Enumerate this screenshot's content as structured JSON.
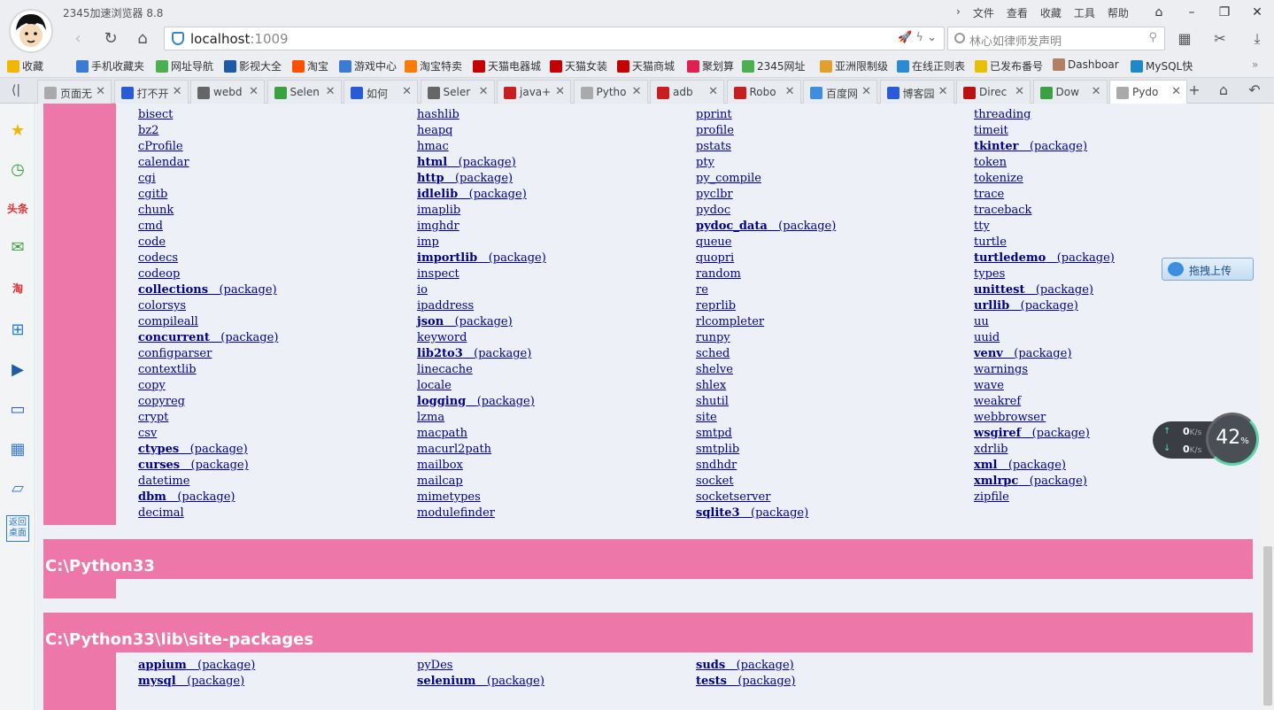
{
  "browser": {
    "title": "2345加速浏览器 8.8",
    "menu": [
      "文件",
      "查看",
      "收藏",
      "工具",
      "帮助"
    ],
    "address": "localhost",
    "port": ":1009",
    "search_placeholder": "林心如律师发声明"
  },
  "bookmarks": [
    {
      "label": "收藏",
      "icon": "star-icon"
    },
    {
      "label": "手机收藏夹",
      "icon": "phone-icon"
    },
    {
      "label": "网址导航",
      "icon": "nav-icon"
    },
    {
      "label": "影视大全",
      "icon": "film-icon"
    },
    {
      "label": "淘宝",
      "icon": "taobao-icon"
    },
    {
      "label": "游戏中心",
      "icon": "game-icon"
    },
    {
      "label": "淘宝特卖",
      "icon": "sale-icon"
    },
    {
      "label": "天猫电器城",
      "icon": "tmall-icon"
    },
    {
      "label": "天猫女装",
      "icon": "tmall-icon"
    },
    {
      "label": "天猫商城",
      "icon": "tmall-icon"
    },
    {
      "label": "聚划算",
      "icon": "juhuasuan-icon"
    },
    {
      "label": "2345网址",
      "icon": "nav-icon"
    },
    {
      "label": "亚洲限制级",
      "icon": "folder-icon"
    },
    {
      "label": "在线正则表",
      "icon": "regex-icon"
    },
    {
      "label": "已发布番号",
      "icon": "radiation-icon"
    },
    {
      "label": "Dashboar",
      "icon": "user-icon"
    },
    {
      "label": "MySQL快",
      "icon": "mysql-icon"
    }
  ],
  "tabs": [
    {
      "label": "页面无",
      "icon": "page-icon"
    },
    {
      "label": "打不开",
      "icon": "paw-icon"
    },
    {
      "label": "webd",
      "icon": "w-icon"
    },
    {
      "label": "Selen",
      "icon": "check-icon"
    },
    {
      "label": "如何",
      "icon": "paw-icon"
    },
    {
      "label": "Seler",
      "icon": "w-icon"
    },
    {
      "label": "java+",
      "icon": "c-icon"
    },
    {
      "label": "Pytho",
      "icon": "page-icon"
    },
    {
      "label": "adb",
      "icon": "c-icon"
    },
    {
      "label": "Robo",
      "icon": "c-icon"
    },
    {
      "label": "百度网",
      "icon": "cloud-icon"
    },
    {
      "label": "博客园",
      "icon": "paw-icon"
    },
    {
      "label": "Direc",
      "icon": "redhat-icon"
    },
    {
      "label": "Dow",
      "icon": "check-icon"
    },
    {
      "label": "Pydo",
      "icon": "page-icon"
    }
  ],
  "sidebar": [
    {
      "label": "",
      "icon": "star-icon"
    },
    {
      "label": "",
      "icon": "clock-icon"
    },
    {
      "label": "头条",
      "icon": "news-icon"
    },
    {
      "label": "",
      "icon": "wechat-icon"
    },
    {
      "label": "淘",
      "icon": "taobao-icon"
    },
    {
      "label": "",
      "icon": "gamepad-icon"
    },
    {
      "label": "",
      "icon": "video-icon"
    },
    {
      "label": "",
      "icon": "computer-icon"
    },
    {
      "label": "",
      "icon": "calculator-icon"
    },
    {
      "label": "",
      "icon": "notebook-icon"
    },
    {
      "label": "返回桌面",
      "icon": "desktop-icon"
    }
  ],
  "modules": {
    "col1": [
      {
        "n": "bisect"
      },
      {
        "n": "bz2"
      },
      {
        "n": "cProfile"
      },
      {
        "n": "calendar"
      },
      {
        "n": "cgi"
      },
      {
        "n": "cgitb"
      },
      {
        "n": "chunk"
      },
      {
        "n": "cmd"
      },
      {
        "n": "code"
      },
      {
        "n": "codecs"
      },
      {
        "n": "codeop"
      },
      {
        "n": "collections",
        "p": true
      },
      {
        "n": "colorsys"
      },
      {
        "n": "compileall"
      },
      {
        "n": "concurrent",
        "p": true
      },
      {
        "n": "configparser"
      },
      {
        "n": "contextlib"
      },
      {
        "n": "copy"
      },
      {
        "n": "copyreg"
      },
      {
        "n": "crypt"
      },
      {
        "n": "csv"
      },
      {
        "n": "ctypes",
        "p": true
      },
      {
        "n": "curses",
        "p": true
      },
      {
        "n": "datetime"
      },
      {
        "n": "dbm",
        "p": true
      },
      {
        "n": "decimal"
      }
    ],
    "col2": [
      {
        "n": "hashlib"
      },
      {
        "n": "heapq"
      },
      {
        "n": "hmac"
      },
      {
        "n": "html",
        "p": true
      },
      {
        "n": "http",
        "p": true
      },
      {
        "n": "idlelib",
        "p": true
      },
      {
        "n": "imaplib"
      },
      {
        "n": "imghdr"
      },
      {
        "n": "imp"
      },
      {
        "n": "importlib",
        "p": true
      },
      {
        "n": "inspect"
      },
      {
        "n": "io"
      },
      {
        "n": "ipaddress"
      },
      {
        "n": "json",
        "p": true
      },
      {
        "n": "keyword"
      },
      {
        "n": "lib2to3",
        "p": true
      },
      {
        "n": "linecache"
      },
      {
        "n": "locale"
      },
      {
        "n": "logging",
        "p": true
      },
      {
        "n": "lzma"
      },
      {
        "n": "macpath"
      },
      {
        "n": "macurl2path"
      },
      {
        "n": "mailbox"
      },
      {
        "n": "mailcap"
      },
      {
        "n": "mimetypes"
      },
      {
        "n": "modulefinder"
      }
    ],
    "col3": [
      {
        "n": "pprint"
      },
      {
        "n": "profile"
      },
      {
        "n": "pstats"
      },
      {
        "n": "pty"
      },
      {
        "n": "py_compile"
      },
      {
        "n": "pyclbr"
      },
      {
        "n": "pydoc"
      },
      {
        "n": "pydoc_data",
        "p": true
      },
      {
        "n": "queue"
      },
      {
        "n": "quopri"
      },
      {
        "n": "random"
      },
      {
        "n": "re"
      },
      {
        "n": "reprlib"
      },
      {
        "n": "rlcompleter"
      },
      {
        "n": "runpy"
      },
      {
        "n": "sched"
      },
      {
        "n": "shelve"
      },
      {
        "n": "shlex"
      },
      {
        "n": "shutil"
      },
      {
        "n": "site"
      },
      {
        "n": "smtpd"
      },
      {
        "n": "smtplib"
      },
      {
        "n": "sndhdr"
      },
      {
        "n": "socket"
      },
      {
        "n": "socketserver"
      },
      {
        "n": "sqlite3",
        "p": true
      }
    ],
    "col4": [
      {
        "n": "threading"
      },
      {
        "n": "timeit"
      },
      {
        "n": "tkinter",
        "p": true
      },
      {
        "n": "token"
      },
      {
        "n": "tokenize"
      },
      {
        "n": "trace"
      },
      {
        "n": "traceback"
      },
      {
        "n": "tty"
      },
      {
        "n": "turtle"
      },
      {
        "n": "turtledemo",
        "p": true
      },
      {
        "n": "types"
      },
      {
        "n": "unittest",
        "p": true
      },
      {
        "n": "urllib",
        "p": true
      },
      {
        "n": "uu"
      },
      {
        "n": "uuid"
      },
      {
        "n": "venv",
        "p": true
      },
      {
        "n": "warnings"
      },
      {
        "n": "wave"
      },
      {
        "n": "weakref"
      },
      {
        "n": "webbrowser"
      },
      {
        "n": "wsgiref",
        "p": true
      },
      {
        "n": "xdrlib"
      },
      {
        "n": "xml",
        "p": true
      },
      {
        "n": "xmlrpc",
        "p": true
      },
      {
        "n": "zipfile"
      }
    ]
  },
  "package_suffix": "(package)",
  "sections": {
    "python33": "C:\\Python33",
    "site_packages": "C:\\Python33\\lib\\site-packages"
  },
  "site_packages": {
    "col1": [
      {
        "n": "appium",
        "p": true
      },
      {
        "n": "mysql",
        "p": true
      }
    ],
    "col2": [
      {
        "n": "pyDes"
      },
      {
        "n": "selenium",
        "p": true
      }
    ],
    "col3": [
      {
        "n": "suds",
        "p": true
      },
      {
        "n": "tests",
        "p": true
      }
    ]
  },
  "widgets": {
    "upload_label": "拖拽上传",
    "net_up": "0",
    "net_down": "0",
    "net_unit": "K/s",
    "cpu_percent": "42",
    "percent_sign": "%"
  }
}
